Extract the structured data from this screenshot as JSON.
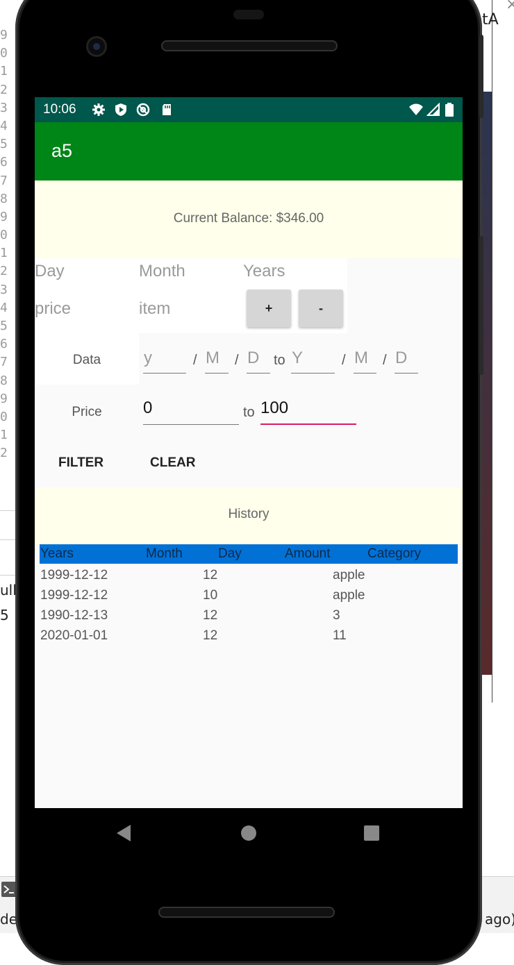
{
  "ide": {
    "gutter": [
      "9",
      "0",
      "1",
      "2",
      "3",
      "4",
      "5",
      "6",
      "7",
      "8",
      "9",
      "0",
      "1",
      "2",
      "3",
      "4",
      "5",
      "6",
      "7",
      "8",
      "9",
      "0",
      "1",
      "2"
    ],
    "frag_right_top": "tA",
    "frag_close": "×",
    "frag_left_1": "ull",
    "frag_left_2": "5",
    "frag_bottom_left": "de",
    "frag_bottom_right": "ago)",
    "terminal_icon": "terminal-icon"
  },
  "status_bar": {
    "time": "10:06",
    "left_icons": [
      "gear-icon",
      "shield-play-icon",
      "at-sign-icon",
      "sd-card-icon"
    ],
    "right_icons": [
      "wifi-icon",
      "signal-icon",
      "battery-icon"
    ]
  },
  "app_bar": {
    "title": "a5"
  },
  "balance": {
    "text": "Current Balance: $346.00"
  },
  "entry": {
    "day_placeholder": "Day",
    "month_placeholder": "Month",
    "years_placeholder": "Years",
    "price_placeholder": "price",
    "item_placeholder": "item",
    "add_label": "+",
    "subtract_label": "-"
  },
  "date_filter": {
    "label": "Data",
    "from_y": "y",
    "from_m": "M",
    "from_d": "D",
    "to_word": "to",
    "to_y": "Y",
    "to_m": "M",
    "to_d": "D",
    "sep": "/"
  },
  "price_filter": {
    "label": "Price",
    "min_value": "0",
    "to_word": "to",
    "max_value": "100"
  },
  "actions": {
    "filter_label": "FILTER",
    "clear_label": "CLEAR"
  },
  "history": {
    "title": "History"
  },
  "table": {
    "headers": [
      "Years",
      "Month",
      "Day",
      "Amount",
      "Category"
    ],
    "rows": [
      {
        "date": "1999-12-12",
        "amount": "12",
        "category": "apple"
      },
      {
        "date": "1999-12-12",
        "amount": "10",
        "category": "apple"
      },
      {
        "date": "1990-12-13",
        "amount": "12",
        "category": "3"
      },
      {
        "date": "2020-01-01",
        "amount": "12",
        "category": "11"
      }
    ]
  },
  "nav": {
    "back": "back-icon",
    "home": "home-icon",
    "recents": "recents-icon"
  },
  "colors": {
    "status_bar": "#00574b",
    "app_bar": "#008517",
    "highlight_box": "#ffffeb",
    "table_header": "#0271d6",
    "accent_underline": "#d81b60"
  }
}
